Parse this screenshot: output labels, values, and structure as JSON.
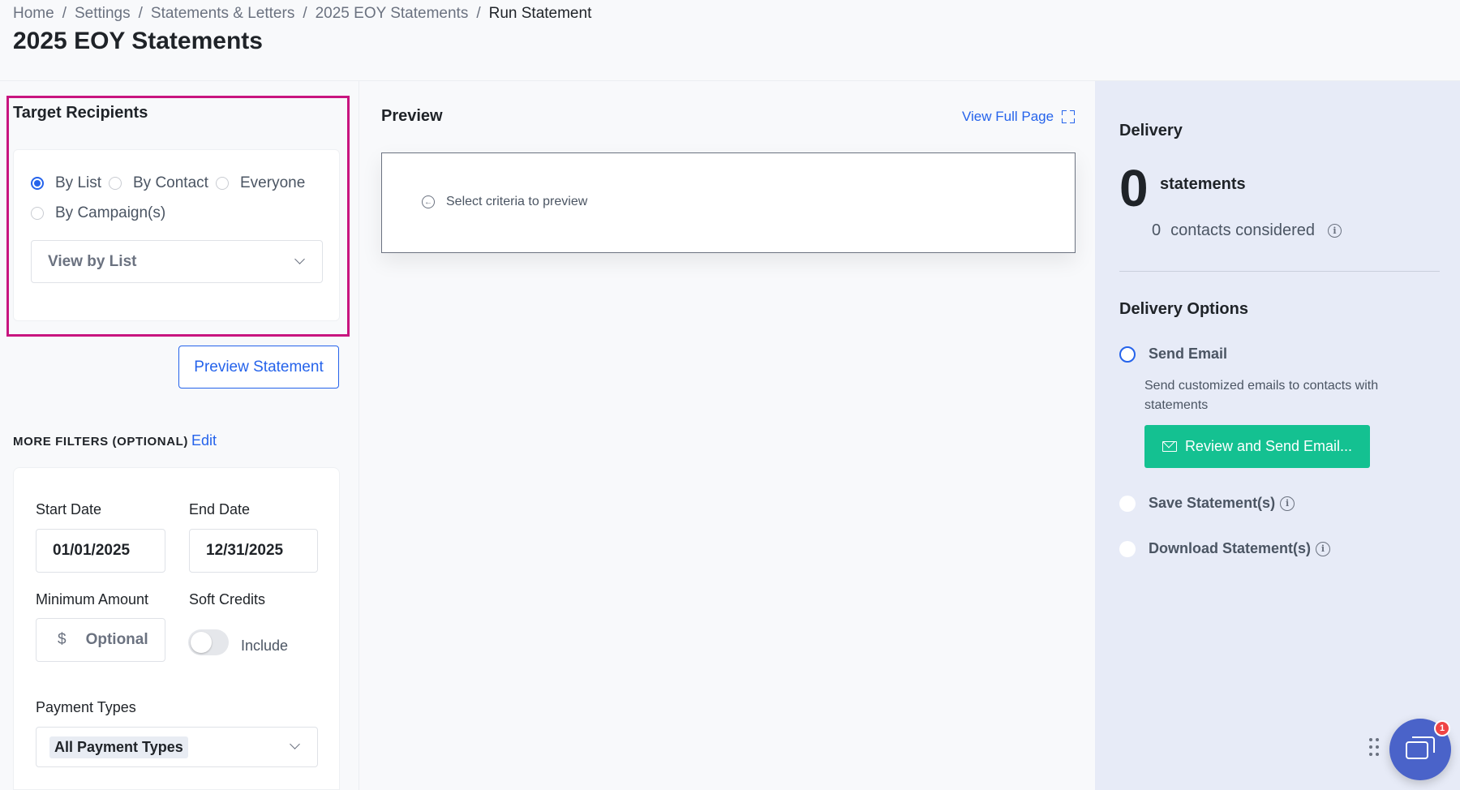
{
  "breadcrumb": {
    "items": [
      "Home",
      "Settings",
      "Statements & Letters",
      "2025 EOY Statements"
    ],
    "current": "Run Statement",
    "separator": "/"
  },
  "page_title": "2025 EOY Statements",
  "target_recipients": {
    "title": "Target Recipients",
    "options": {
      "by_list": "By List",
      "by_contact": "By Contact",
      "everyone": "Everyone",
      "by_campaign": "By Campaign(s)"
    },
    "selected": "By List",
    "list_select_value": "View by List",
    "highlight_color": "#c8157f"
  },
  "preview_button": "Preview Statement",
  "more_filters": {
    "label": "MORE FILTERS (OPTIONAL)",
    "edit": "Edit",
    "start_date_label": "Start Date",
    "start_date_value": "01/01/2025",
    "end_date_label": "End Date",
    "end_date_value": "12/31/2025",
    "min_amount_label": "Minimum Amount",
    "min_amount_prefix": "$",
    "min_amount_placeholder": "Optional",
    "soft_credits_label": "Soft Credits",
    "soft_credits_toggle_label": "Include",
    "soft_credits_on": false,
    "payment_types_label": "Payment Types",
    "payment_types_value": "All Payment Types"
  },
  "preview": {
    "title": "Preview",
    "view_full_page": "View Full Page",
    "empty_message": "Select criteria to preview"
  },
  "delivery": {
    "title": "Delivery",
    "statement_count": "0",
    "statements_label": "statements",
    "contacts_count": "0",
    "contacts_label": "contacts considered",
    "options_title": "Delivery Options",
    "send_email_label": "Send Email",
    "send_email_desc": "Send customized emails to contacts with statements",
    "send_email_button": "Review and Send Email...",
    "save_label": "Save Statement(s)",
    "download_label": "Download Statement(s)",
    "selected_option": "Send Email",
    "accent_color": "#2563eb",
    "button_color": "#14c191"
  },
  "chat": {
    "badge_count": "1"
  }
}
